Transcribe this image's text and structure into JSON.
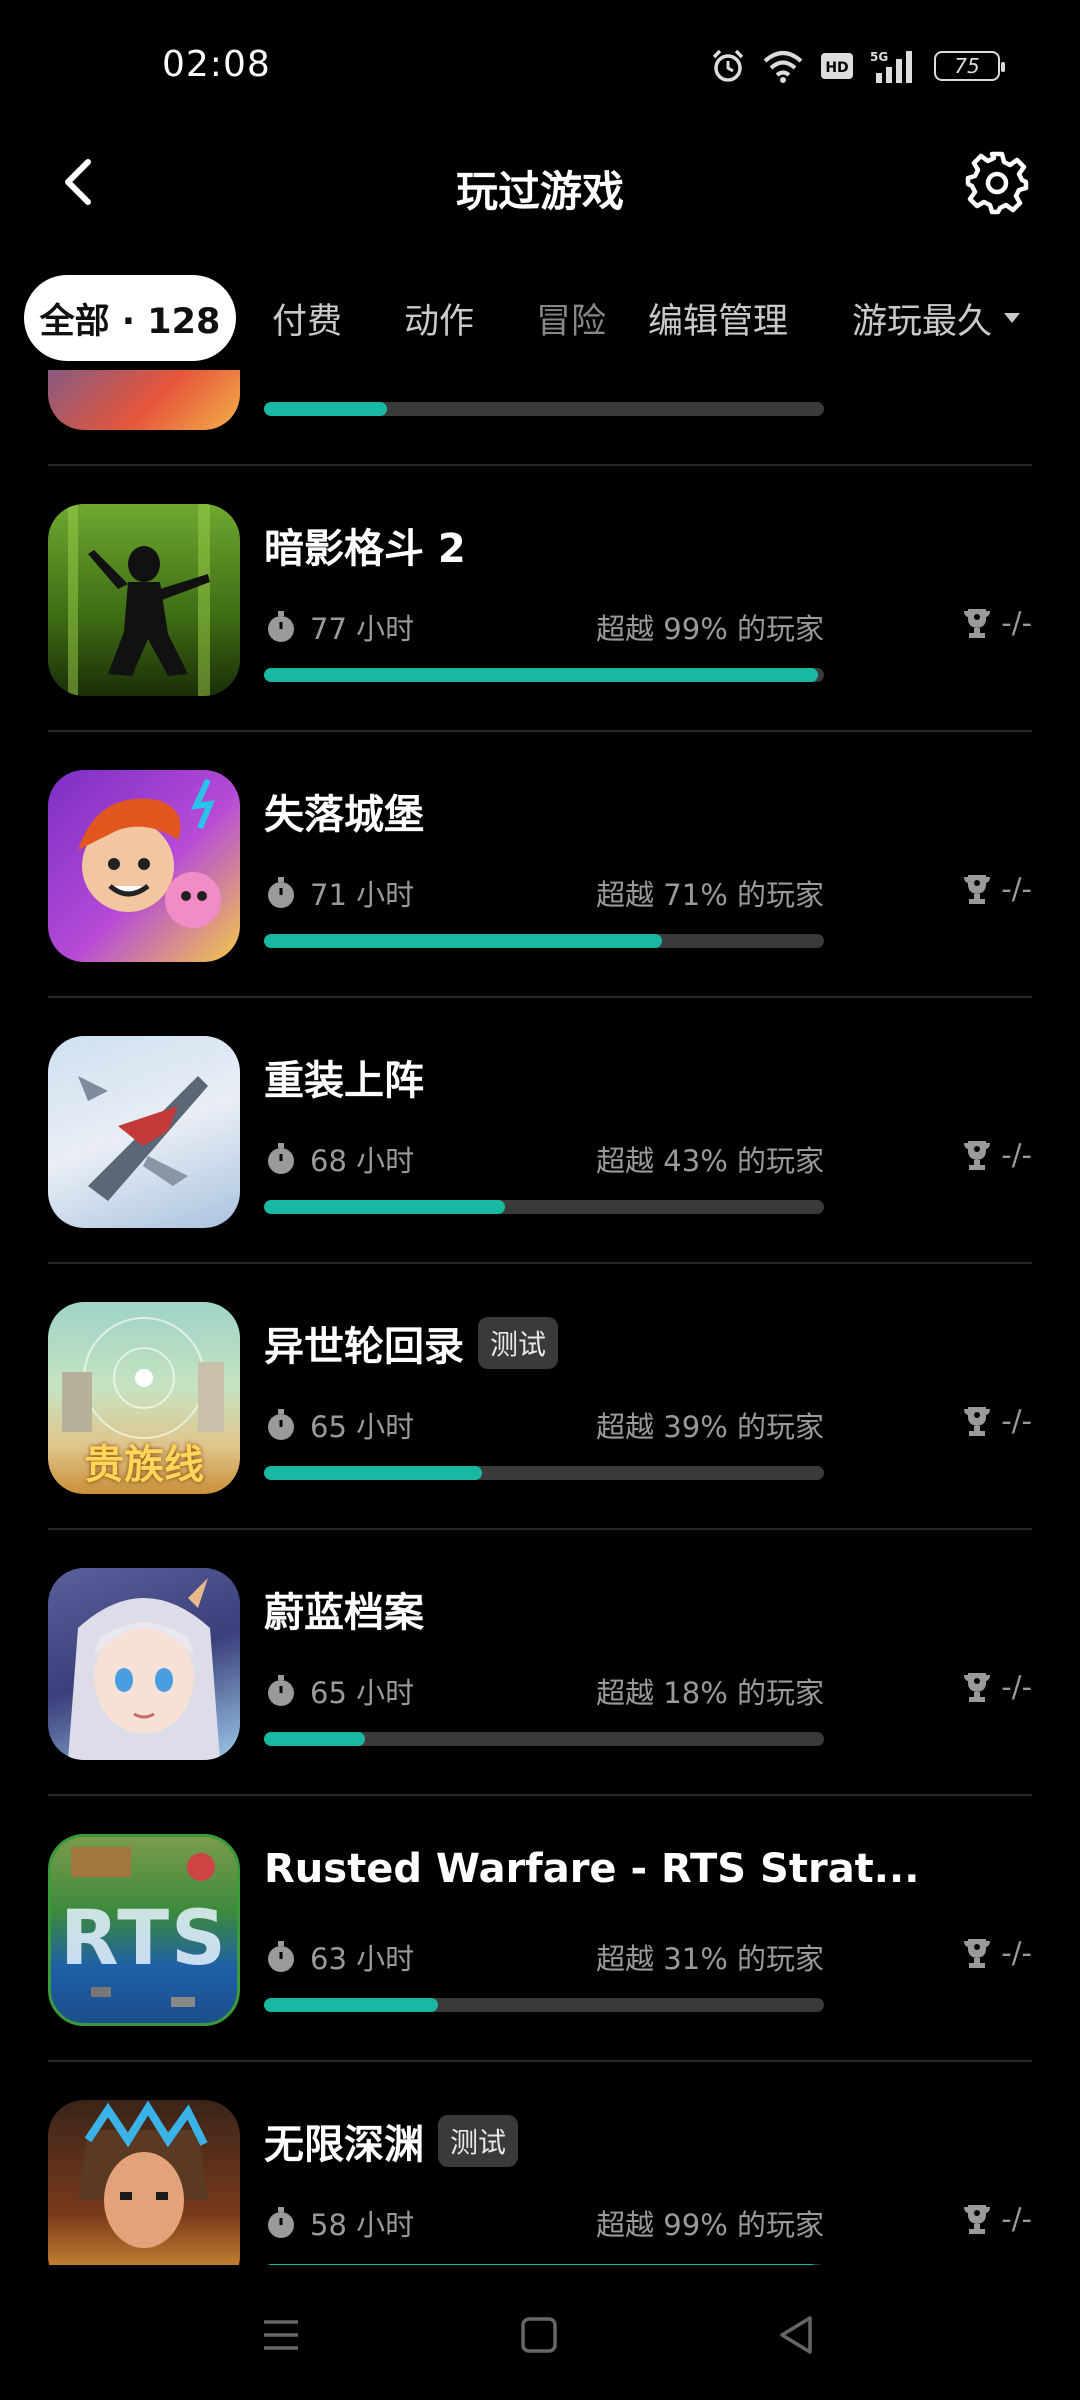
{
  "status_bar": {
    "time": "02:08",
    "battery": "75",
    "icons": [
      "alarm-icon",
      "wifi-icon",
      "hd-icon",
      "5g-signal-icon",
      "battery-icon"
    ]
  },
  "header": {
    "title": "玩过游戏",
    "back_icon": "back-arrow-icon",
    "settings_icon": "gear-icon"
  },
  "tabs": [
    {
      "label": "全部 · 128",
      "active": true
    },
    {
      "label": "付费"
    },
    {
      "label": "动作"
    },
    {
      "label": "冒险"
    },
    {
      "label": "编辑管理"
    },
    {
      "label": "游玩最久"
    }
  ],
  "games": [
    {
      "name": "",
      "hours": "",
      "beat": "",
      "progress": 0.22,
      "trophy": "",
      "icon": "game-icon-partial"
    },
    {
      "name": "暗影格斗 2",
      "hours": "77 小时",
      "beat": "超越 99% 的玩家",
      "progress": 0.99,
      "trophy": "-/-",
      "icon": "shadow-fight-icon"
    },
    {
      "name": "失落城堡",
      "hours": "71 小时",
      "beat": "超越 71% 的玩家",
      "progress": 0.71,
      "trophy": "-/-",
      "icon": "lost-castle-icon"
    },
    {
      "name": "重装上阵",
      "hours": "68 小时",
      "beat": "超越 43% 的玩家",
      "progress": 0.43,
      "trophy": "-/-",
      "icon": "jet-fighter-icon"
    },
    {
      "name": "异世轮回录",
      "tag": "测试",
      "thumb_text": "贵族线",
      "hours": "65 小时",
      "beat": "超越 39% 的玩家",
      "progress": 0.39,
      "trophy": "-/-",
      "icon": "castle-landscape-icon"
    },
    {
      "name": "蔚蓝档案",
      "hours": "65 小时",
      "beat": "超越 18% 的玩家",
      "progress": 0.18,
      "trophy": "-/-",
      "icon": "anime-girl-icon"
    },
    {
      "name": "Rusted Warfare - RTS Strat...",
      "thumb_text": "RTS",
      "hours": "63 小时",
      "beat": "超越 31% 的玩家",
      "progress": 0.31,
      "trophy": "-/-",
      "icon": "rts-map-icon"
    },
    {
      "name": "无限深渊",
      "tag": "测试",
      "hours": "58 小时",
      "beat": "超越 99% 的玩家",
      "progress": 0.99,
      "trophy": "-/-",
      "icon": "pixel-warrior-icon"
    }
  ],
  "navbar": {
    "icons": [
      "menu-icon",
      "home-icon",
      "back-triangle-icon"
    ]
  },
  "colors": {
    "background": "#000000",
    "accent": "#19b8a3",
    "track": "#3a3a3a",
    "muted_text": "#9a9a9a"
  }
}
